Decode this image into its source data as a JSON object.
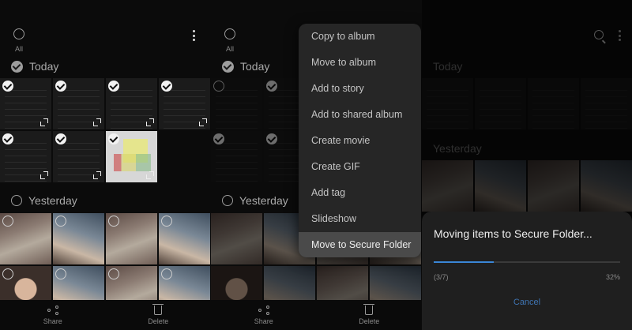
{
  "all_label": "All",
  "sections": {
    "today": "Today",
    "yesterday": "Yesterday"
  },
  "bottom_actions": {
    "share": "Share",
    "delete": "Delete"
  },
  "menu": {
    "items": [
      "Copy to album",
      "Move to album",
      "Add to story",
      "Add to shared album",
      "Create movie",
      "Create GIF",
      "Add tag",
      "Slideshow",
      "Move to Secure Folder"
    ],
    "active_index": 8
  },
  "dialog": {
    "title": "Moving items to Secure Folder...",
    "count": "(3/7)",
    "percent": "32%",
    "progress_fraction": 0.32,
    "cancel": "Cancel"
  },
  "colors": {
    "accent": "#3a86d6",
    "cancel": "#3f74b2",
    "menu_bg": "#262626",
    "menu_active": "#4a4a4a"
  },
  "icons": [
    "more-options-icon",
    "search-icon",
    "share-icon",
    "delete-icon",
    "checkmark-icon",
    "expand-icon"
  ]
}
